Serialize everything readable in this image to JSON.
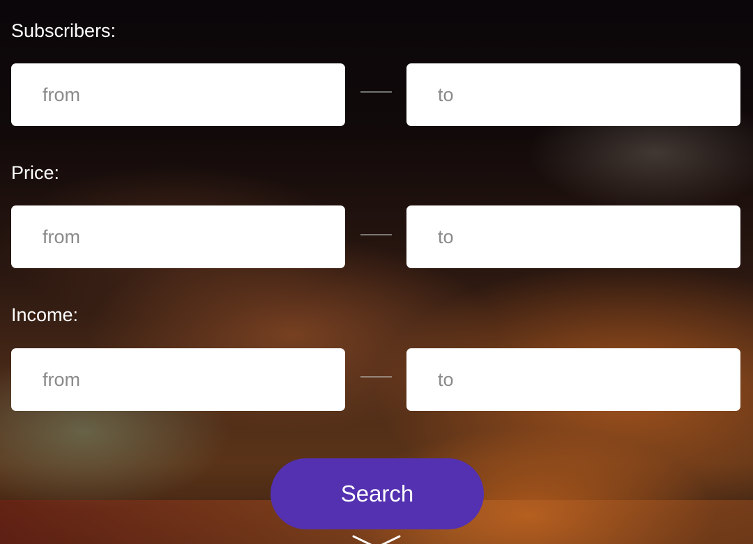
{
  "filters": {
    "subscribers": {
      "label": "Subscribers:",
      "from_placeholder": "from",
      "to_placeholder": "to",
      "from_value": "",
      "to_value": ""
    },
    "price": {
      "label": "Price:",
      "from_placeholder": "from",
      "to_placeholder": "to",
      "from_value": "",
      "to_value": ""
    },
    "income": {
      "label": "Income:",
      "from_placeholder": "from",
      "to_placeholder": "to",
      "from_value": "",
      "to_value": ""
    }
  },
  "search_button": {
    "label": "Search",
    "color": "#5431b0"
  },
  "colors": {
    "label_text": "#ffffff",
    "field_bg": "#ffffff",
    "placeholder": "#8a8a8a"
  },
  "icons": {
    "scroll_down": "chevron-down-icon"
  }
}
